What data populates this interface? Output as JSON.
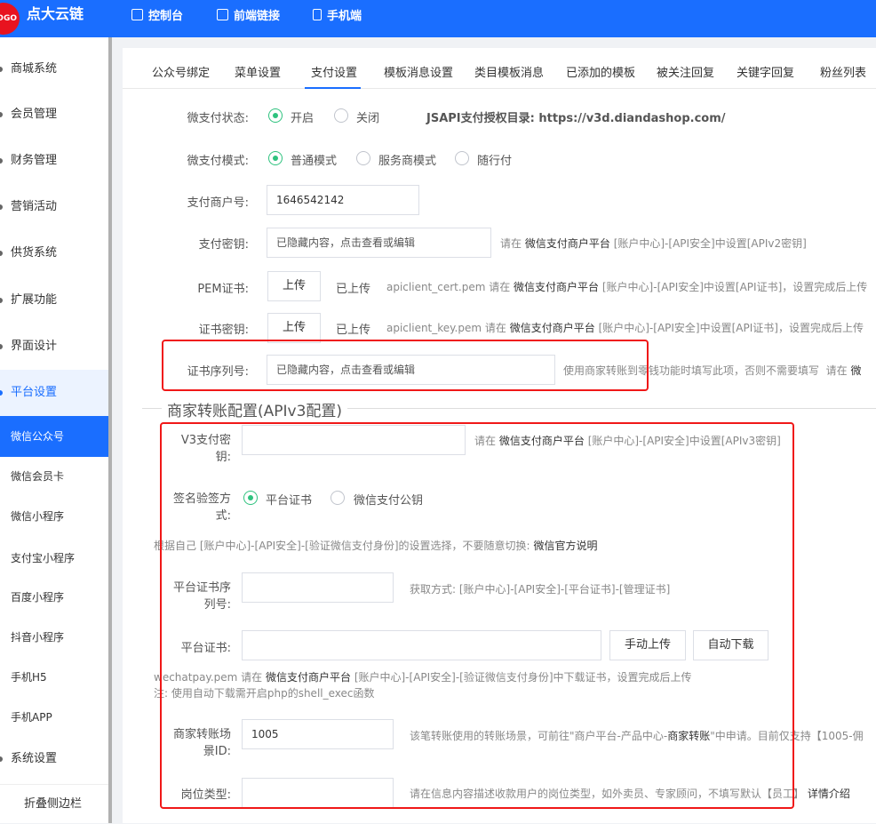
{
  "header": {
    "logo_text": "OGO",
    "app_title": "点大云链",
    "nav": [
      {
        "label": "控制台",
        "icon": "dashboard-icon"
      },
      {
        "label": "前端链接",
        "icon": "link-icon"
      },
      {
        "label": "手机端",
        "icon": "mobile-icon"
      }
    ]
  },
  "sidebar": {
    "items": [
      {
        "label": "商城系统"
      },
      {
        "label": "会员管理"
      },
      {
        "label": "财务管理"
      },
      {
        "label": "营销活动"
      },
      {
        "label": "供货系统"
      },
      {
        "label": "扩展功能"
      },
      {
        "label": "界面设计"
      },
      {
        "label": "平台设置"
      }
    ],
    "sub_items": [
      {
        "label": "微信公众号"
      },
      {
        "label": "微信会员卡"
      },
      {
        "label": "微信小程序"
      },
      {
        "label": "支付宝小程序"
      },
      {
        "label": "百度小程序"
      },
      {
        "label": "抖音小程序"
      },
      {
        "label": "手机H5"
      },
      {
        "label": "手机APP"
      }
    ],
    "system_settings": "系统设置",
    "fold_label": "折叠侧边栏"
  },
  "tabs": [
    "公众号绑定",
    "菜单设置",
    "支付设置",
    "模板消息设置",
    "类目模板消息",
    "已添加的模板",
    "被关注回复",
    "关键字回复",
    "粉丝列表"
  ],
  "form": {
    "wxpay_status_label": "微支付状态:",
    "wxpay_status_on": "开启",
    "wxpay_status_off": "关闭",
    "jsapi_dir": "JSAPI支付授权目录: https://v3d.diandashop.com/",
    "wxpay_mode_label": "微支付模式:",
    "mode_normal": "普通模式",
    "mode_service": "服务商模式",
    "mode_follow": "随行付",
    "merchant_no_label": "支付商户号:",
    "merchant_no_value": "1646542142",
    "pay_key_label": "支付密钥:",
    "pay_key_value": "已隐藏内容，点击查看或编辑",
    "pay_key_hint_pre": "请在",
    "pay_key_hint_platform": "微信支付商户平台",
    "pay_key_hint_post": "[账户中心]-[API安全]中设置[APIv2密钥]",
    "pem_label": "PEM证书:",
    "upload_btn": "上传",
    "uploaded": "已上传",
    "pem_hint_pre": "apiclient_cert.pem 请在",
    "pem_hint_platform": "微信支付商户平台",
    "pem_hint_post": "[账户中心]-[API安全]中设置[API证书]，设置完成后上传",
    "cert_key_label": "证书密钥:",
    "cert_key_hint_pre": "apiclient_key.pem 请在",
    "cert_key_hint_platform": "微信支付商户平台",
    "cert_key_hint_post": "[账户中心]-[API安全]中设置[API证书]，设置完成后上传",
    "cert_serial_label": "证书序列号:",
    "cert_serial_value": "已隐藏内容，点击查看或编辑",
    "cert_serial_hint": "使用商家转账到零钱功能时填写此项，否则不需要填写",
    "cert_serial_hint2": "请在",
    "cert_serial_hint3": "微"
  },
  "v3": {
    "legend": "商家转账配置(APIv3配置)",
    "v3_key_label_1": "V3支付密",
    "v3_key_label_2": "钥:",
    "v3_key_hint_pre": "请在",
    "v3_key_hint_platform": "微信支付商户平台",
    "v3_key_hint_post": "[账户中心]-[API安全]中设置[APIv3密钥]",
    "sign_label_1": "签名验签方",
    "sign_label_2": "式:",
    "sign_platform_cert": "平台证书",
    "sign_pubkey": "微信支付公钥",
    "sign_hint": "根据自己 [账户中心]-[API安全]-[验证微信支付身份]的设置选择，不要随意切换:",
    "sign_hint_link": "微信官方说明",
    "platform_serial_label_1": "平台证书序",
    "platform_serial_label_2": "列号:",
    "platform_serial_hint": "获取方式: [账户中心]-[API安全]-[平台证书]-[管理证书]",
    "platform_cert_label": "平台证书:",
    "manual_upload": "手动上传",
    "auto_download": "自动下载",
    "wechatpay_hint_pre": "wechatpay.pem 请在",
    "wechatpay_hint_platform": "微信支付商户平台",
    "wechatpay_hint_post": "[账户中心]-[API安全]-[验证微信支付身份]中下载证书，设置完成后上传",
    "auto_download_note": "注: 使用自动下载需开启php的shell_exec函数",
    "scene_label_1": "商家转账场",
    "scene_label_2": "景ID:",
    "scene_value": "1005",
    "scene_hint_pre": "该笔转账使用的转账场景，可前往\"商户平台-产品中心-",
    "scene_hint_bold": "商家转账",
    "scene_hint_post": "\"中申请。目前仅支持【1005-佣",
    "post_type_label": "岗位类型:",
    "post_type_hint": "请在信息内容描述收款用户的岗位类型，如外卖员、专家顾问，不填写默认【员工】",
    "post_type_link": "详情介绍"
  }
}
